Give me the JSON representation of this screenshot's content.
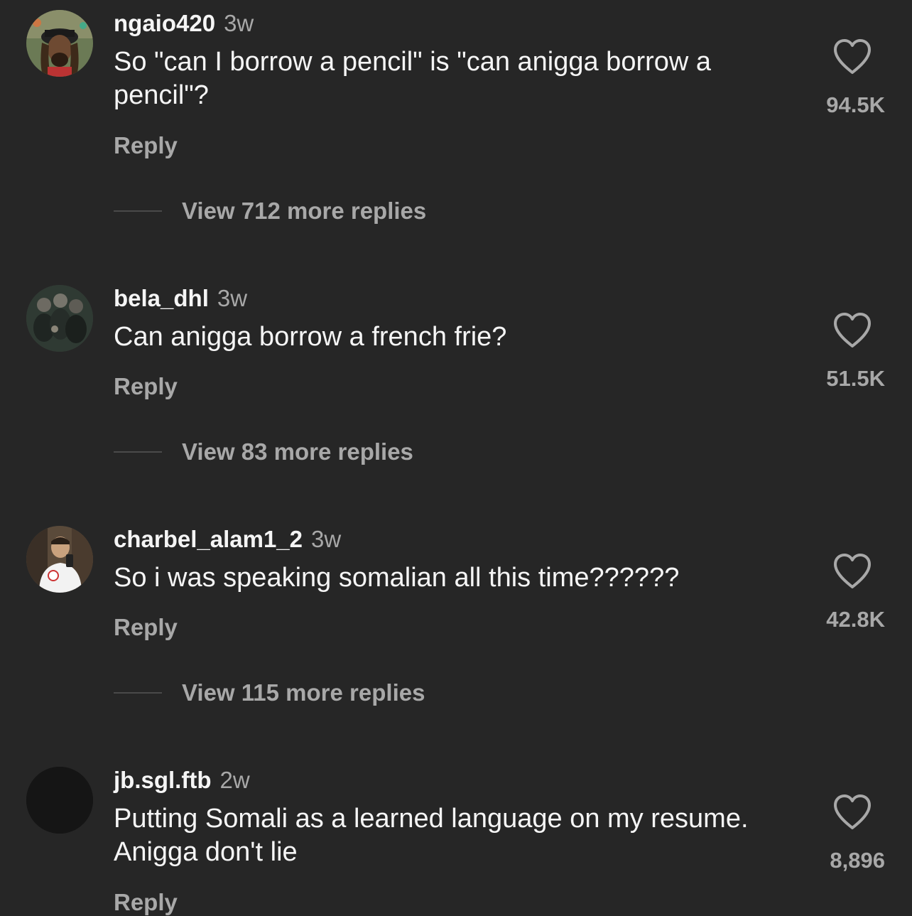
{
  "comments": [
    {
      "username": "ngaio420",
      "time": "3w",
      "text": "So \"can I borrow a pencil\" is \"can anigga borrow a pencil\"?",
      "reply_label": "Reply",
      "view_more": "View 712 more replies",
      "likes": "94.5K",
      "avatar_icon": "dreadlocks-person-avatar"
    },
    {
      "username": "bela_dhl",
      "time": "3w",
      "text": "Can anigga borrow a french frie?",
      "reply_label": "Reply",
      "view_more": "View 83 more replies",
      "likes": "51.5K",
      "avatar_icon": "group-photo-avatar"
    },
    {
      "username": "charbel_alam1_2",
      "time": "3w",
      "text": "So i was speaking somalian all this time??????",
      "reply_label": "Reply",
      "view_more": "View 115 more replies",
      "likes": "42.8K",
      "avatar_icon": "mirror-selfie-avatar"
    },
    {
      "username": "jb.sgl.ftb",
      "time": "2w",
      "text": "Putting Somali as a learned language on my resume. Anigga don't lie",
      "reply_label": "Reply",
      "likes": "8,896",
      "avatar_icon": "dark-avatar"
    }
  ],
  "colors": {
    "background": "#262626",
    "primary_text": "#f5f5f5",
    "secondary_text": "#a8a8a8"
  }
}
